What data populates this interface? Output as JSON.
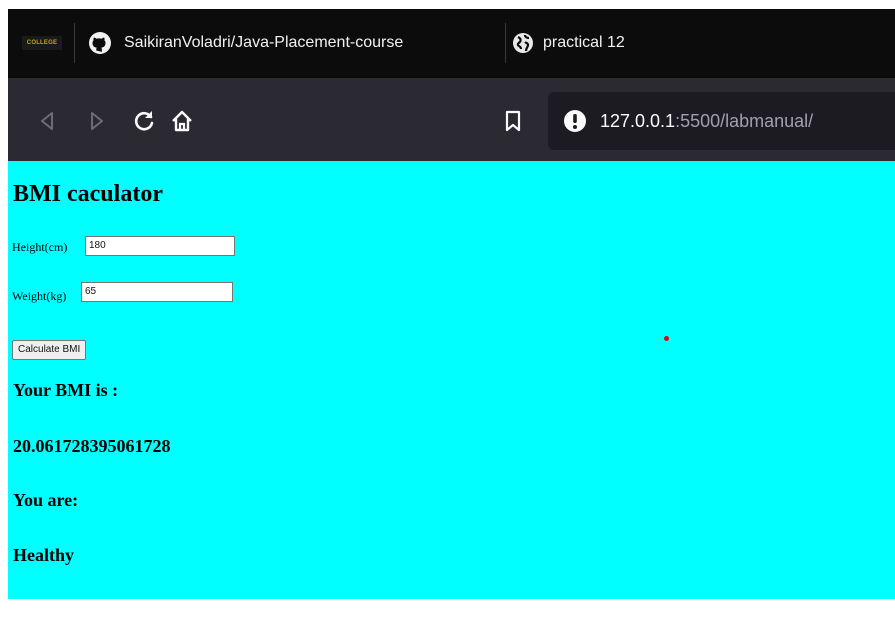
{
  "browser": {
    "tabs": [
      {
        "logo_text": "COLLEGE",
        "icon": "github-icon",
        "title": "SaikiranVoladri/Java-Placement-course"
      },
      {
        "icon": "globe-icon",
        "title": "practical 12"
      }
    ],
    "nav": {
      "back_icon": "back-arrow-icon",
      "forward_icon": "forward-arrow-icon",
      "reload_icon": "reload-icon",
      "home_icon": "home-icon",
      "bookmark_icon": "bookmark-icon"
    },
    "url": {
      "security_icon": "warning-icon",
      "host": "127.0.0.1",
      "rest": ":5500/labmanual/"
    }
  },
  "page": {
    "background": "#00ffff",
    "title": "BMI caculator",
    "height_label": "Height(cm)",
    "height_value": "180",
    "weight_label": "Weight(kg)",
    "weight_value": "65",
    "button_label": "Calculate BMI",
    "result_label": "Your BMI is :",
    "result_value": "20.061728395061728",
    "status_label": "You are:",
    "status_value": "Healthy"
  }
}
